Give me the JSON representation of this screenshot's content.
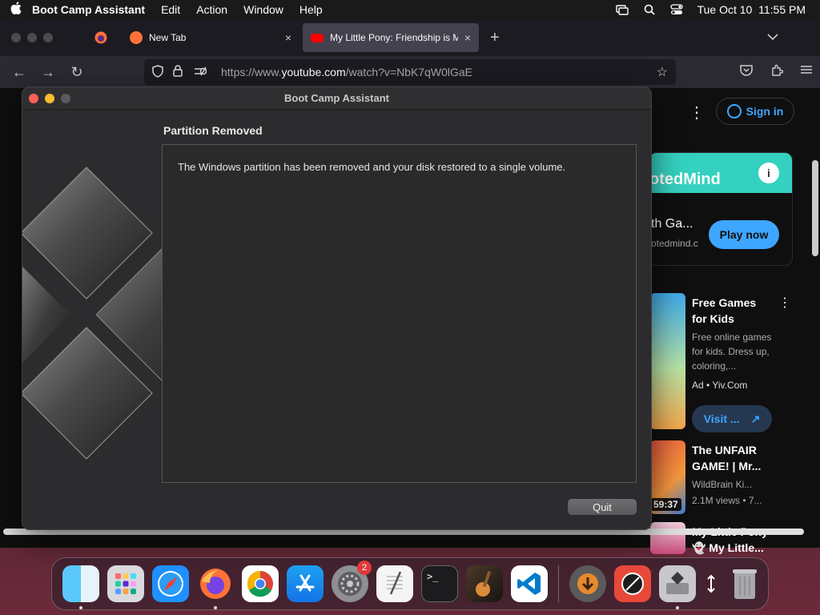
{
  "menubar": {
    "apple_icon": "apple-logo",
    "app_name": "Boot Camp Assistant",
    "menus": [
      "Edit",
      "Action",
      "Window",
      "Help"
    ],
    "datetime": "Tue Oct 10  11:55 PM"
  },
  "browser": {
    "tabs": [
      {
        "title": "New Tab",
        "close": "×"
      },
      {
        "title": "My Little Pony: Friendship is Ma",
        "close": "×"
      }
    ],
    "new_tab": "+",
    "url_prefix": "https://www.",
    "url_host": "youtube.com",
    "url_path": "/watch?v=NbK7qW0lGaE"
  },
  "youtube": {
    "more": "⋮",
    "sign_in": "Sign in",
    "ad": {
      "brand": "otedMind",
      "title": "th Ga...",
      "domain": "otedmind.c",
      "play_now": "Play now"
    },
    "side_items": [
      {
        "title": "Free Games for Kids",
        "meta1": "Free online games for kids. Dress up, coloring,...",
        "meta2": "Ad • Yiv.Com",
        "visit": "Visit ..."
      },
      {
        "title": "The UNFAIR GAME! | Mr...",
        "channel": "WildBrain Ki...",
        "views": "2.1M views • 7...",
        "duration": "59:37"
      },
      {
        "title": "My Little Pony 👻 My Little..."
      }
    ]
  },
  "dialog": {
    "title": "Boot Camp Assistant",
    "heading": "Partition Removed",
    "message": "The Windows partition has been removed and your disk restored to a single volume.",
    "quit": "Quit"
  },
  "dock": {
    "items": [
      "finder-icon",
      "launchpad-icon",
      "safari-icon",
      "firefox-icon",
      "chrome-icon",
      "app-store-icon",
      "system-settings-icon",
      "textedit-icon",
      "terminal-icon",
      "garageband-icon",
      "vscode-icon",
      "downloads-icon",
      "instruments-icon",
      "boot-camp-icon",
      "resize-icon",
      "trash-icon"
    ],
    "settings_badge": "2"
  },
  "colors": {
    "accent": "#3ea6ff",
    "dialog_bg": "#2c2c2e",
    "close": "#ff5f57",
    "minimize": "#febc2e"
  }
}
